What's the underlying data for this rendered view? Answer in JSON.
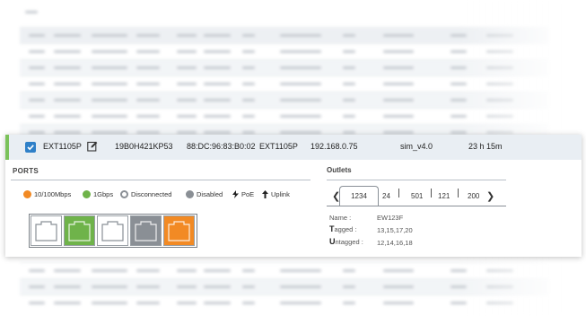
{
  "device_row": {
    "checked": true,
    "name": "EXT1105P",
    "serial": "19B0H421KP53",
    "mac": "88:DC:96:83:B0:02",
    "model": "EXT1105P",
    "ip": "192.168.0.75",
    "firmware": "sim_v4.0",
    "uptime": "23 h 15m",
    "status_color": "#7bc25a",
    "edit_icon": "edit-icon"
  },
  "ports": {
    "title": "PORTS",
    "legend": [
      {
        "label": "10/100Mbps",
        "icon": "dot-orange",
        "color": "#f28a24"
      },
      {
        "label": "1Gbps",
        "icon": "dot-green",
        "color": "#6fb34a"
      },
      {
        "label": "Disconnected",
        "icon": "dot-ring",
        "color": "#8a8f95"
      },
      {
        "label": "Disabled",
        "icon": "dot-gray",
        "color": "#8a8f95"
      },
      {
        "label": "PoE",
        "icon": "bolt-icon"
      },
      {
        "label": "Uplink",
        "icon": "arrow-up-icon"
      }
    ],
    "port_list": [
      {
        "state": "disconnected",
        "color": "#ffffff"
      },
      {
        "state": "1Gbps",
        "color": "#6fb34a"
      },
      {
        "state": "disconnected",
        "color": "#ffffff"
      },
      {
        "state": "disabled",
        "color": "#8a8f95"
      },
      {
        "state": "10/100Mbps",
        "color": "#f28a24"
      }
    ]
  },
  "outlets": {
    "title": "Outlets",
    "tabs": [
      "1234",
      "24",
      "501",
      "121",
      "200"
    ],
    "active_tab": "1234",
    "name_label": "Name :",
    "name_value": "EW123F",
    "tagged_label_first": "T",
    "tagged_label_rest": "agged :",
    "tagged_value": "13,15,17,20",
    "untagged_label_first": "U",
    "untagged_label_rest": "ntagged :",
    "untagged_value": "12,14,16,18"
  }
}
